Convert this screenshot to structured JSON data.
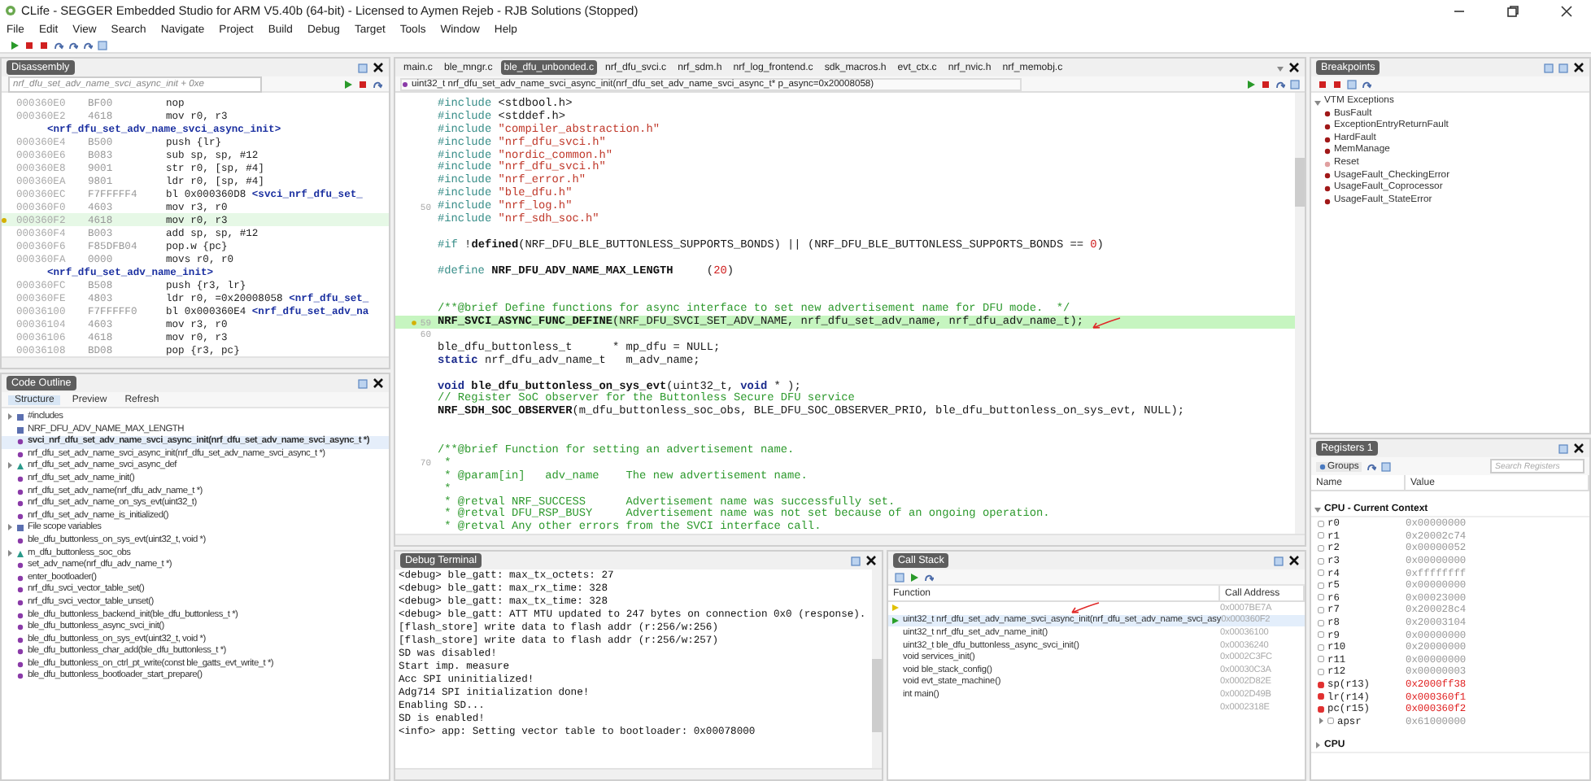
{
  "window": {
    "title": "CLife - SEGGER Embedded Studio for ARM V5.40b (64-bit) - Licensed to Aymen Rejeb - RJB Solutions (Stopped)"
  },
  "menu": [
    "File",
    "Edit",
    "View",
    "Search",
    "Navigate",
    "Project",
    "Build",
    "Debug",
    "Target",
    "Tools",
    "Window",
    "Help"
  ],
  "disassembly": {
    "title": "Disassembly",
    "location": "nrf_dfu_set_adv_name_svci_async_init + 0xe",
    "lines": [
      {
        "kind": "instruction",
        "address": "000360E0",
        "opcode": "BF00",
        "instruction": "nop",
        "current": false
      },
      {
        "kind": "instruction",
        "address": "000360E2",
        "opcode": "4618",
        "instruction": "mov r0, r3",
        "current": false
      },
      {
        "kind": "label",
        "text": "<nrf_dfu_set_adv_name_svci_async_init>"
      },
      {
        "kind": "instruction",
        "address": "000360E4",
        "opcode": "B500",
        "instruction": "push {lr}",
        "current": false
      },
      {
        "kind": "instruction",
        "address": "000360E6",
        "opcode": "B083",
        "instruction": "sub sp, sp, #12",
        "current": false
      },
      {
        "kind": "instruction",
        "address": "000360E8",
        "opcode": "9001",
        "instruction": "str r0, [sp, #4]",
        "current": false
      },
      {
        "kind": "instruction",
        "address": "000360EA",
        "opcode": "9801",
        "instruction": "ldr r0, [sp, #4]",
        "current": false
      },
      {
        "kind": "instruction",
        "address": "000360EC",
        "opcode": "F7FFFFF4",
        "instruction": "bl 0x000360D8",
        "symbol": "<svci_nrf_dfu_set_",
        "current": false
      },
      {
        "kind": "instruction",
        "address": "000360F0",
        "opcode": "4603",
        "instruction": "mov r3, r0",
        "current": false
      },
      {
        "kind": "instruction",
        "address": "000360F2",
        "opcode": "4618",
        "instruction": "mov r0, r3",
        "current": true
      },
      {
        "kind": "instruction",
        "address": "000360F4",
        "opcode": "B003",
        "instruction": "add sp, sp, #12",
        "current": false
      },
      {
        "kind": "instruction",
        "address": "000360F6",
        "opcode": "F85DFB04",
        "instruction": "pop.w {pc}",
        "current": false
      },
      {
        "kind": "instruction",
        "address": "000360FA",
        "opcode": "0000",
        "instruction": "movs r0, r0",
        "current": false
      },
      {
        "kind": "label",
        "text": "<nrf_dfu_set_adv_name_init>"
      },
      {
        "kind": "instruction",
        "address": "000360FC",
        "opcode": "B508",
        "instruction": "push {r3, lr}",
        "current": false
      },
      {
        "kind": "instruction",
        "address": "000360FE",
        "opcode": "4803",
        "instruction": "ldr r0, =0x20008058",
        "symbol": "<nrf_dfu_set_",
        "current": false
      },
      {
        "kind": "instruction",
        "address": "00036100",
        "opcode": "F7FFFFF0",
        "instruction": "bl 0x000360E4",
        "symbol": "<nrf_dfu_set_adv_na",
        "current": false
      },
      {
        "kind": "instruction",
        "address": "00036104",
        "opcode": "4603",
        "instruction": "mov r3, r0",
        "current": false
      },
      {
        "kind": "instruction",
        "address": "00036106",
        "opcode": "4618",
        "instruction": "mov r0, r3",
        "current": false
      },
      {
        "kind": "instruction",
        "address": "00036108",
        "opcode": "BD08",
        "instruction": "pop {r3, pc}",
        "current": false
      }
    ]
  },
  "code_outline": {
    "title": "Code Outline",
    "toolbar": [
      {
        "label": "Structure",
        "selected": true
      },
      {
        "label": "Preview",
        "selected": false
      },
      {
        "label": "Refresh",
        "selected": false
      }
    ],
    "items": [
      {
        "kind": "group",
        "label": "#includes",
        "expanded": false,
        "selected": false
      },
      {
        "kind": "macro",
        "label": "NRF_DFU_ADV_NAME_MAX_LENGTH",
        "selected": false
      },
      {
        "kind": "function",
        "label": "svci_nrf_dfu_set_adv_name_svci_async_init(nrf_dfu_set_adv_name_svci_async_t *)",
        "selected": true
      },
      {
        "kind": "function",
        "label": "nrf_dfu_set_adv_name_svci_async_init(nrf_dfu_set_adv_name_svci_async_t *)",
        "selected": false
      },
      {
        "kind": "variable",
        "label": "nrf_dfu_set_adv_name_svci_async_def",
        "expanded": false,
        "selected": false
      },
      {
        "kind": "function",
        "label": "nrf_dfu_set_adv_name_init()",
        "selected": false
      },
      {
        "kind": "function",
        "label": "nrf_dfu_set_adv_name(nrf_dfu_adv_name_t *)",
        "selected": false
      },
      {
        "kind": "function",
        "label": "nrf_dfu_set_adv_name_on_sys_evt(uint32_t)",
        "selected": false
      },
      {
        "kind": "function",
        "label": "nrf_dfu_set_adv_name_is_initialized()",
        "selected": false
      },
      {
        "kind": "group",
        "label": "File scope variables",
        "expanded": false,
        "selected": false
      },
      {
        "kind": "function",
        "label": "ble_dfu_buttonless_on_sys_evt(uint32_t, void *)",
        "selected": false
      },
      {
        "kind": "variable",
        "label": "m_dfu_buttonless_soc_obs",
        "expanded": false,
        "selected": false
      },
      {
        "kind": "function",
        "label": "set_adv_name(nrf_dfu_adv_name_t *)",
        "selected": false
      },
      {
        "kind": "function",
        "label": "enter_bootloader()",
        "selected": false
      },
      {
        "kind": "function",
        "label": "nrf_dfu_svci_vector_table_set()",
        "selected": false
      },
      {
        "kind": "function",
        "label": "nrf_dfu_svci_vector_table_unset()",
        "selected": false
      },
      {
        "kind": "function",
        "label": "ble_dfu_buttonless_backend_init(ble_dfu_buttonless_t *)",
        "selected": false
      },
      {
        "kind": "function",
        "label": "ble_dfu_buttonless_async_svci_init()",
        "selected": false
      },
      {
        "kind": "function",
        "label": "ble_dfu_buttonless_on_sys_evt(uint32_t, void *)",
        "selected": false
      },
      {
        "kind": "function",
        "label": "ble_dfu_buttonless_char_add(ble_dfu_buttonless_t *)",
        "selected": false
      },
      {
        "kind": "function",
        "label": "ble_dfu_buttonless_on_ctrl_pt_write(const ble_gatts_evt_write_t *)",
        "selected": false
      },
      {
        "kind": "function",
        "label": "ble_dfu_buttonless_bootloader_start_prepare()",
        "selected": false
      }
    ]
  },
  "editor": {
    "tabs": [
      {
        "label": "main.c",
        "selected": false
      },
      {
        "label": "ble_mngr.c",
        "selected": false
      },
      {
        "label": "ble_dfu_unbonded.c",
        "selected": true
      },
      {
        "label": "nrf_dfu_svci.c",
        "selected": false
      },
      {
        "label": "nrf_sdm.h",
        "selected": false
      },
      {
        "label": "nrf_log_frontend.c",
        "selected": false
      },
      {
        "label": "sdk_macros.h",
        "selected": false
      },
      {
        "label": "evt_ctx.c",
        "selected": false
      },
      {
        "label": "nrf_nvic.h",
        "selected": false
      },
      {
        "label": "nrf_memobj.c",
        "selected": false
      }
    ],
    "function": "uint32_t nrf_dfu_set_adv_name_svci_async_init(nrf_dfu_set_adv_name_svci_async_t* p_async=0x20008058)",
    "lines": [
      {
        "kind": "code",
        "tokens": [
          {
            "kind": "directive",
            "text": "#include "
          },
          {
            "kind": "plain",
            "text": "<stdbool.h>"
          }
        ]
      },
      {
        "kind": "code",
        "tokens": [
          {
            "kind": "directive",
            "text": "#include "
          },
          {
            "kind": "plain",
            "text": "<stddef.h>"
          }
        ]
      },
      {
        "kind": "code",
        "tokens": [
          {
            "kind": "directive",
            "text": "#include "
          },
          {
            "kind": "string",
            "text": "\"compiler_abstraction.h\""
          }
        ]
      },
      {
        "kind": "code",
        "tokens": [
          {
            "kind": "directive",
            "text": "#include "
          },
          {
            "kind": "string",
            "text": "\"nrf_dfu_svci.h\""
          }
        ]
      },
      {
        "kind": "code",
        "tokens": [
          {
            "kind": "directive",
            "text": "#include "
          },
          {
            "kind": "string",
            "text": "\"nordic_common.h\""
          }
        ]
      },
      {
        "kind": "code",
        "tokens": [
          {
            "kind": "directive",
            "text": "#include "
          },
          {
            "kind": "string",
            "text": "\"nrf_dfu_svci.h\""
          }
        ]
      },
      {
        "kind": "code",
        "tokens": [
          {
            "kind": "directive",
            "text": "#include "
          },
          {
            "kind": "string",
            "text": "\"nrf_error.h\""
          }
        ]
      },
      {
        "kind": "code",
        "tokens": [
          {
            "kind": "directive",
            "text": "#include "
          },
          {
            "kind": "string",
            "text": "\"ble_dfu.h\""
          }
        ]
      },
      {
        "kind": "code",
        "number": "50",
        "tokens": [
          {
            "kind": "directive",
            "text": "#include "
          },
          {
            "kind": "string",
            "text": "\"nrf_log.h\""
          }
        ]
      },
      {
        "kind": "code",
        "tokens": [
          {
            "kind": "directive",
            "text": "#include "
          },
          {
            "kind": "string",
            "text": "\"nrf_sdh_soc.h\""
          }
        ]
      },
      {
        "kind": "blank"
      },
      {
        "kind": "code",
        "tokens": [
          {
            "kind": "directive",
            "text": "#if "
          },
          {
            "kind": "plain",
            "text": "!"
          },
          {
            "kind": "bold",
            "text": "defined"
          },
          {
            "kind": "plain",
            "text": "(NRF_DFU_BLE_BUTTONLESS_SUPPORTS_BONDS) || (NRF_DFU_BLE_BUTTONLESS_SUPPORTS_BONDS == "
          },
          {
            "kind": "number",
            "text": "0"
          },
          {
            "kind": "plain",
            "text": ")"
          }
        ]
      },
      {
        "kind": "blank"
      },
      {
        "kind": "code",
        "tokens": [
          {
            "kind": "directive",
            "text": "#define "
          },
          {
            "kind": "bold",
            "text": "NRF_DFU_ADV_NAME_MAX_LENGTH"
          },
          {
            "kind": "plain",
            "text": "     ("
          },
          {
            "kind": "number",
            "text": "20"
          },
          {
            "kind": "plain",
            "text": ")"
          }
        ]
      },
      {
        "kind": "blank"
      },
      {
        "kind": "blank"
      },
      {
        "kind": "code",
        "tokens": [
          {
            "kind": "comment",
            "text": "/**@brief Define functions for async interface to set new advertisement name for DFU mode.  */"
          }
        ]
      },
      {
        "kind": "code",
        "number": "59",
        "current": true,
        "tokens": [
          {
            "kind": "bold",
            "text": "NRF_SVCI_ASYNC_FUNC_DEFINE"
          },
          {
            "kind": "plain",
            "text": "(NRF_DFU_SVCI_SET_ADV_NAME, nrf_dfu_set_adv_name, nrf_dfu_adv_name_t);"
          }
        ]
      },
      {
        "kind": "blank",
        "number": "60"
      },
      {
        "kind": "code",
        "tokens": [
          {
            "kind": "plain",
            "text": "ble_dfu_buttonless_t      * mp_dfu = NULL;"
          }
        ]
      },
      {
        "kind": "code",
        "tokens": [
          {
            "kind": "keyword",
            "text": "static"
          },
          {
            "kind": "plain",
            "text": " nrf_dfu_adv_name_t   m_adv_name;"
          }
        ]
      },
      {
        "kind": "blank"
      },
      {
        "kind": "code",
        "tokens": [
          {
            "kind": "keyword",
            "text": "void"
          },
          {
            "kind": "bold",
            "text": " ble_dfu_buttonless_on_sys_evt"
          },
          {
            "kind": "plain",
            "text": "(uint32_t, "
          },
          {
            "kind": "keyword",
            "text": "void"
          },
          {
            "kind": "plain",
            "text": " * );"
          }
        ]
      },
      {
        "kind": "code",
        "tokens": [
          {
            "kind": "comment",
            "text": "// Register SoC observer for the Buttonless Secure DFU service"
          }
        ]
      },
      {
        "kind": "code",
        "tokens": [
          {
            "kind": "bold",
            "text": "NRF_SDH_SOC_OBSERVER"
          },
          {
            "kind": "plain",
            "text": "(m_dfu_buttonless_soc_obs, BLE_DFU_SOC_OBSERVER_PRIO, ble_dfu_buttonless_on_sys_evt, NULL);"
          }
        ]
      },
      {
        "kind": "blank"
      },
      {
        "kind": "blank"
      },
      {
        "kind": "code",
        "tokens": [
          {
            "kind": "comment",
            "text": "/**@brief Function for setting an advertisement name."
          }
        ]
      },
      {
        "kind": "code",
        "number": "70",
        "tokens": [
          {
            "kind": "comment",
            "text": " *"
          }
        ]
      },
      {
        "kind": "code",
        "tokens": [
          {
            "kind": "comment",
            "text": " * @param[in]   adv_name    The new advertisement name."
          }
        ]
      },
      {
        "kind": "code",
        "tokens": [
          {
            "kind": "comment",
            "text": " *"
          }
        ]
      },
      {
        "kind": "code",
        "tokens": [
          {
            "kind": "comment",
            "text": " * @retval NRF_SUCCESS      Advertisement name was successfully set."
          }
        ]
      },
      {
        "kind": "code",
        "tokens": [
          {
            "kind": "comment",
            "text": " * @retval DFU_RSP_BUSY     Advertisement name was not set because of an ongoing operation."
          }
        ]
      },
      {
        "kind": "code",
        "tokens": [
          {
            "kind": "comment",
            "text": " * @retval Any other errors from the SVCI interface call."
          }
        ]
      }
    ]
  },
  "debug_terminal": {
    "title": "Debug Terminal",
    "lines": [
      "<debug> ble_gatt: max_tx_octets: 27",
      "<debug> ble_gatt: max_rx_time: 328",
      "<debug> ble_gatt: max_tx_time: 328",
      "<debug> ble_gatt: ATT MTU updated to 247 bytes on connection 0x0 (response).",
      "[flash_store] write data to flash addr (r:256/w:256)",
      "[flash_store] write data to flash addr (r:256/w:257)",
      "SD was disabled!",
      "Start imp. measure",
      "Acc SPI uninitialized!",
      "Adg714 SPI initialization done!",
      "Enabling SD...",
      "SD is enabled!",
      "<info> app: Setting vector table to bootloader: 0x00078000"
    ]
  },
  "call_stack": {
    "title": "Call Stack",
    "columns": [
      "Function",
      "Call Address"
    ],
    "rows": [
      {
        "kind": "pc",
        "address": "0x0007BE7A",
        "selected": false
      },
      {
        "kind": "frame",
        "function": "uint32_t nrf_dfu_set_adv_name_svci_async_init(nrf_dfu_set_adv_name_svci_asy",
        "address": "0x000360F2",
        "selected": true
      },
      {
        "kind": "caller",
        "function": "uint32_t nrf_dfu_set_adv_name_init()",
        "address": "0x00036100",
        "selected": false
      },
      {
        "kind": "caller",
        "function": "uint32_t ble_dfu_buttonless_async_svci_init()",
        "address": "0x00036240",
        "selected": false
      },
      {
        "kind": "caller",
        "function": "void services_init()",
        "address": "0x0002C3FC",
        "selected": false
      },
      {
        "kind": "caller",
        "function": "void ble_stack_config()",
        "address": "0x00030C3A",
        "selected": false
      },
      {
        "kind": "caller",
        "function": "void evt_state_machine()",
        "address": "0x0002D82E",
        "selected": false
      },
      {
        "kind": "caller",
        "function": "int main()",
        "address": "0x0002D49B",
        "selected": false
      },
      {
        "kind": "caller",
        "address": "0x0002318E",
        "selected": false
      }
    ]
  },
  "breakpoints": {
    "title": "Breakpoints",
    "tree": [
      {
        "label": "VTM Exceptions",
        "expanded": true,
        "children": [
          {
            "label": "BusFault",
            "enabled": true
          },
          {
            "label": "ExceptionEntryReturnFault",
            "enabled": true
          },
          {
            "label": "HardFault",
            "enabled": true
          },
          {
            "label": "MemManage",
            "enabled": true
          },
          {
            "label": "Reset",
            "enabled": false
          },
          {
            "label": "UsageFault_CheckingError",
            "enabled": true
          },
          {
            "label": "UsageFault_Coprocessor",
            "enabled": true
          },
          {
            "label": "UsageFault_StateError",
            "enabled": true
          }
        ]
      }
    ]
  },
  "registers": {
    "title": "Registers 1",
    "groups_button": "Groups",
    "search": {
      "placeholder": "Search Registers"
    },
    "columns": [
      "Name",
      "Value"
    ],
    "groups": [
      {
        "label": "CPU - Current Context",
        "expanded": true,
        "rows": [
          {
            "name": "r0",
            "value": "0x00000000",
            "changed": false
          },
          {
            "name": "r1",
            "value": "0x20002c74",
            "changed": false
          },
          {
            "name": "r2",
            "value": "0x00000052",
            "changed": false
          },
          {
            "name": "r3",
            "value": "0x00000000",
            "changed": false
          },
          {
            "name": "r4",
            "value": "0xffffffff",
            "changed": false
          },
          {
            "name": "r5",
            "value": "0x00000000",
            "changed": false
          },
          {
            "name": "r6",
            "value": "0x00023000",
            "changed": false
          },
          {
            "name": "r7",
            "value": "0x200028c4",
            "changed": false
          },
          {
            "name": "r8",
            "value": "0x20003104",
            "changed": false
          },
          {
            "name": "r9",
            "value": "0x00000000",
            "changed": false
          },
          {
            "name": "r10",
            "value": "0x20000000",
            "changed": false
          },
          {
            "name": "r11",
            "value": "0x00000000",
            "changed": false
          },
          {
            "name": "r12",
            "value": "0x00000003",
            "changed": false
          },
          {
            "name": "sp(r13)",
            "value": "0x2000ff38",
            "changed": true
          },
          {
            "name": "lr(r14)",
            "value": "0x000360f1",
            "changed": true
          },
          {
            "name": "pc(r15)",
            "value": "0x000360f2",
            "changed": true
          },
          {
            "name": "apsr",
            "value": "0x61000000",
            "changed": false,
            "expanded": false
          }
        ]
      },
      {
        "label": "CPU",
        "expanded": false
      }
    ]
  }
}
